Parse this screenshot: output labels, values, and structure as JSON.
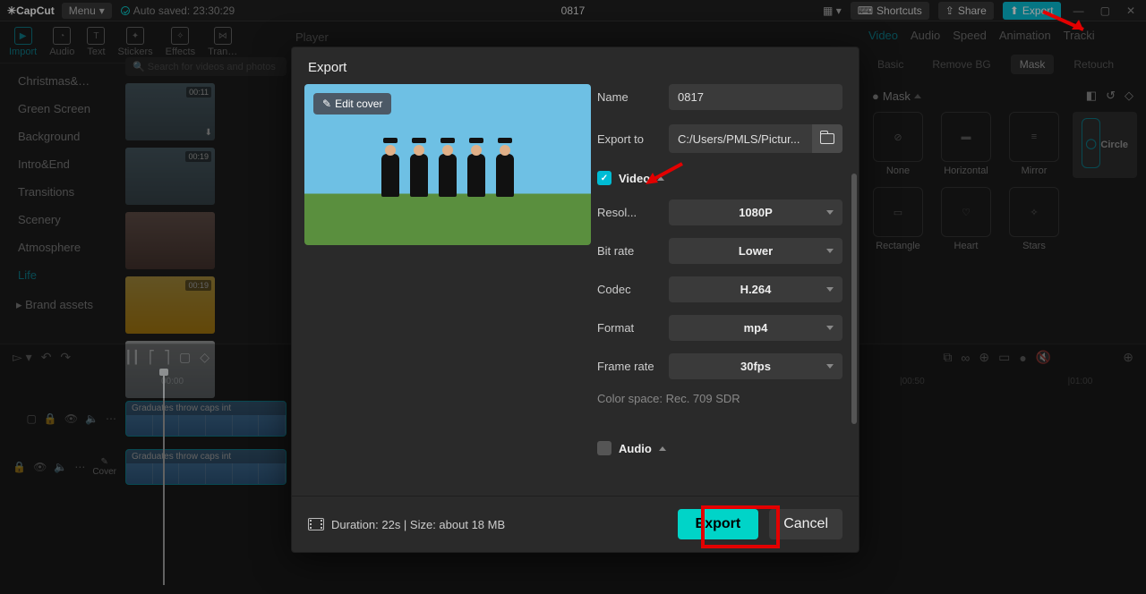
{
  "app": {
    "name": "CapCut",
    "menu": "Menu",
    "autosave": "Auto saved: 23:30:29",
    "project": "0817"
  },
  "topbar": {
    "shortcuts": "Shortcuts",
    "share": "Share",
    "export": "Export"
  },
  "tools": {
    "import": "Import",
    "audio": "Audio",
    "text": "Text",
    "stickers": "Stickers",
    "effects": "Effects",
    "trans": "Tran…"
  },
  "sidecats": [
    "Christmas&…",
    "Green Screen",
    "Background",
    "Intro&End",
    "Transitions",
    "Scenery",
    "Atmosphere",
    "Life"
  ],
  "brand": "Brand assets",
  "search": "Search for videos and photos",
  "thumbs": [
    {
      "dur": "00:11"
    },
    {
      "dur": "00:19"
    },
    {
      "dur": ""
    },
    {
      "dur": "00:19"
    },
    {
      "dur": ""
    }
  ],
  "player": "Player",
  "rightTabs": [
    "Video",
    "Audio",
    "Speed",
    "Animation",
    "Tracki"
  ],
  "subTabs": [
    "Basic",
    "Remove BG",
    "Mask",
    "Retouch"
  ],
  "maskLabel": "Mask",
  "masks": [
    "None",
    "Horizontal",
    "Mirror",
    "Circle",
    "Rectangle",
    "Heart",
    "Stars"
  ],
  "timeline": {
    "times": [
      "00:00",
      "|00:50",
      "|01:00"
    ],
    "clip": "Graduates throw caps int",
    "cover": "Cover"
  },
  "dlg": {
    "title": "Export",
    "editCover": "Edit cover",
    "name": "Name",
    "nameVal": "0817",
    "exportTo": "Export to",
    "path": "C:/Users/PMLS/Pictur...",
    "video": "Video",
    "resol": "Resol...",
    "resolVal": "1080P",
    "bitrate": "Bit rate",
    "bitrateVal": "Lower",
    "codec": "Codec",
    "codecVal": "H.264",
    "format": "Format",
    "formatVal": "mp4",
    "framerate": "Frame rate",
    "framerateVal": "30fps",
    "colorspace": "Color space: Rec. 709 SDR",
    "audio": "Audio",
    "duration": "Duration: 22s | Size: about 18 MB",
    "exportBtn": "Export",
    "cancelBtn": "Cancel"
  }
}
